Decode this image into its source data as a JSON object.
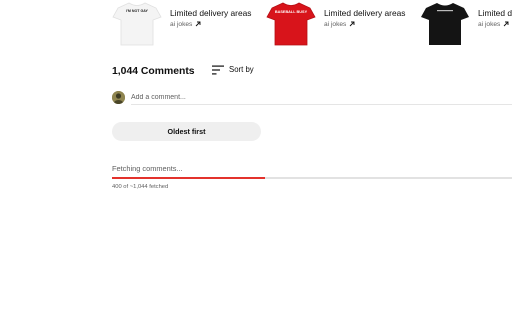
{
  "merch": {
    "items": [
      {
        "title": "Limited delivery areas",
        "seller": "ai jokes",
        "shirt_color": "#f4f4f4",
        "print_color": "#222222",
        "print_text": "I'M NOT GAY"
      },
      {
        "title": "Limited delivery areas",
        "seller": "ai jokes",
        "shirt_color": "#d8141b",
        "print_color": "#ffffff",
        "print_text": "BASEBALL BUSY"
      },
      {
        "title": "Limited delivery areas",
        "seller": "ai jokes",
        "shirt_color": "#141414",
        "print_color": "#dddddd",
        "print_text": ""
      }
    ],
    "external_icon": "open-in-new-icon"
  },
  "comments": {
    "count_label": "1,044 Comments",
    "sort_label": "Sort by",
    "sort_icon": "sort-icon",
    "add_placeholder": "Add a comment...",
    "oldest_first_label": "Oldest first",
    "fetch_status": "Fetching comments...",
    "fetch_count": "400 of ~1,044 fetched",
    "progress_fraction": 0.383,
    "accent_color": "#e3322c"
  }
}
